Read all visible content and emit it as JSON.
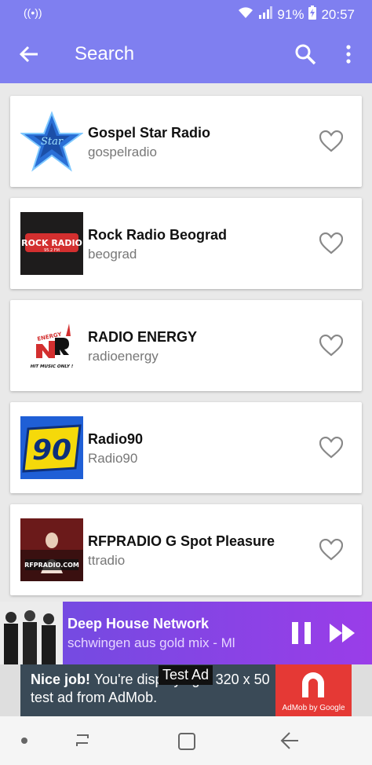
{
  "status_bar": {
    "signal_icon": "hotspot-icon",
    "battery_percent": "91%",
    "time": "20:57"
  },
  "app_bar": {
    "title": "Search"
  },
  "stations": [
    {
      "name": "Gospel Star Radio",
      "id": "gospelradio",
      "logo": "gospel-star-logo"
    },
    {
      "name": "Rock Radio Beograd",
      "id": "beograd",
      "logo": "rock-radio-logo"
    },
    {
      "name": "RADIO ENERGY",
      "id": "radioenergy",
      "logo": "nrj-logo"
    },
    {
      "name": "Radio90",
      "id": "Radio90",
      "logo": "radio90-logo"
    },
    {
      "name": "RFPRADIO G Spot Pleasure",
      "id": "ttradio",
      "logo": "rfpradio-logo"
    }
  ],
  "logos": {
    "rock": "ROCK RADIO",
    "rock_freq": "95.2 FM",
    "energy_word": "ENERGY",
    "energy_tag": "HIT MUSIC ONLY !",
    "radio90": "90",
    "rfp": "RFPRADIO.COM"
  },
  "player": {
    "title": "Deep House Network",
    "subtitle": "schwingen aus gold mix - Ml"
  },
  "ad": {
    "nice": "Nice job!",
    "line1_rest": " You're displaying a 320 x 50",
    "line2": "test ad from AdMob.",
    "badge": "Test Ad",
    "brand": "AdMob by Google"
  },
  "colors": {
    "primary": "#7f7ff0",
    "player_gradient_start": "#6d4de0",
    "player_gradient_end": "#9a3de8",
    "admob_red": "#e53935"
  }
}
